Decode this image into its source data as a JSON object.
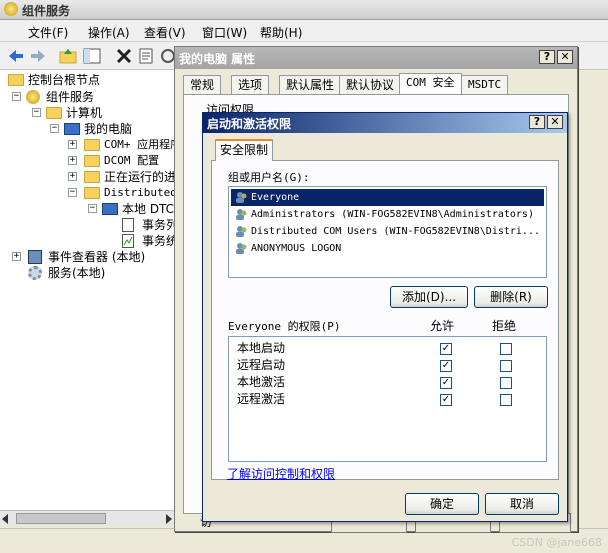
{
  "main": {
    "title": "组件服务",
    "menu": [
      "文件(F)",
      "操作(A)",
      "查看(V)",
      "窗口(W)",
      "帮助(H)"
    ],
    "tree": [
      {
        "label": "控制台根节点",
        "expander": ""
      },
      {
        "label": "组件服务",
        "expander": "−"
      },
      {
        "label": "计算机",
        "expander": "−"
      },
      {
        "label": "我的电脑",
        "expander": "−"
      },
      {
        "label": "COM+ 应用程序",
        "expander": "+"
      },
      {
        "label": "DCOM 配置",
        "expander": "+"
      },
      {
        "label": "正在运行的进程",
        "expander": "+"
      },
      {
        "label": "Distributed",
        "expander": "−"
      },
      {
        "label": "本地 DTC",
        "expander": "−"
      },
      {
        "label": "事务列表",
        "expander": ""
      },
      {
        "label": "事务统计",
        "expander": ""
      },
      {
        "label": "事件查看器 (本地)",
        "expander": "+"
      },
      {
        "label": "服务(本地)",
        "expander": ""
      }
    ]
  },
  "props": {
    "title": "我的电脑 属性",
    "tabs": [
      "常规",
      "选项",
      "默认属性",
      "默认协议",
      "COM 安全",
      "MSDTC"
    ],
    "group_label": "访问权限",
    "partial_text": "访",
    "partial_bottom_text": "访"
  },
  "dialog": {
    "title": "启动和激活权限",
    "tab": "安全限制",
    "users_label": "组或用户名(G):",
    "users": [
      {
        "name": "Everyone",
        "selected": true
      },
      {
        "name": "Administrators (WIN-FOG582EVIN8\\Administrators)",
        "selected": false
      },
      {
        "name": "Distributed COM Users (WIN-FOG582EVIN8\\Distri...",
        "selected": false
      },
      {
        "name": "ANONYMOUS LOGON",
        "selected": false
      }
    ],
    "add_button": "添加(D)...",
    "remove_button": "删除(R)",
    "perm_header": "Everyone 的权限(P)",
    "allow_header": "允许",
    "deny_header": "拒绝",
    "permissions": [
      {
        "name": "本地启动",
        "allow": true,
        "deny": false
      },
      {
        "name": "远程启动",
        "allow": true,
        "deny": false
      },
      {
        "name": "本地激活",
        "allow": true,
        "deny": false
      },
      {
        "name": "远程激活",
        "allow": true,
        "deny": false
      }
    ],
    "learn_link": "了解访问控制和权限",
    "ok_button": "确定",
    "cancel_button": "取消",
    "help_btn": "?",
    "close_btn": "✕"
  },
  "watermark": "CSDN @jane668"
}
